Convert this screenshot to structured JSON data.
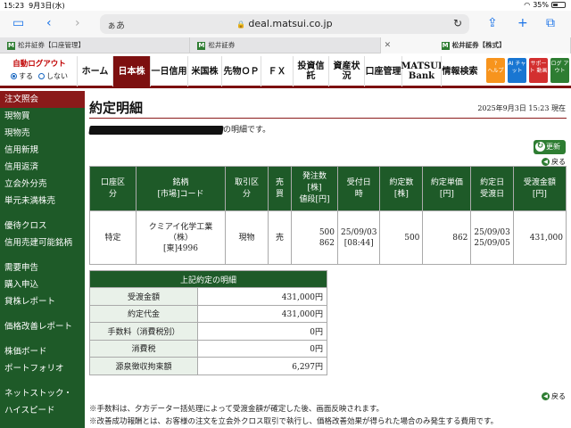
{
  "status_bar": {
    "time": "15:23",
    "date": "9月3日(水)",
    "battery": "35%"
  },
  "browser": {
    "aa": "ぁあ",
    "url": "deal.matsui.co.jp"
  },
  "tabs": [
    {
      "label": "松井証券【口座管理】"
    },
    {
      "label": "松井証券"
    },
    {
      "label": "松井証券【株式】"
    }
  ],
  "header": {
    "auto_logout_title": "自動ログアウト",
    "auto_logout_on": "する",
    "auto_logout_off": "しない",
    "nav": [
      "ホーム",
      "日本株",
      "一日信用",
      "米国株",
      "先物ＯＰ",
      "ＦＸ",
      "投資信託",
      "資産状況",
      "口座管理",
      "MATSUI Bank",
      "情報検索"
    ],
    "icons": [
      {
        "name": "help",
        "label": "ヘルプ",
        "color": "#f7941d"
      },
      {
        "name": "ai-chat",
        "label": "AI チャット",
        "color": "#1976d2"
      },
      {
        "name": "support",
        "label": "サポート 動画",
        "color": "#d32f2f"
      },
      {
        "name": "logout",
        "label": "ログ アウト",
        "color": "#2e7d32"
      }
    ]
  },
  "sidebar": {
    "items": [
      "注文照会",
      "現物買",
      "現物売",
      "信用新規",
      "信用返済",
      "立会外分売",
      "単元未満株売",
      "",
      "優待クロス",
      "信用売建可能銘柄",
      "",
      "需要申告",
      "購入申込",
      "貸株レポート",
      "",
      "価格改善レポート",
      "",
      "株価ボード",
      "ポートフォリオ",
      "",
      "ネットストック・",
      "ハイスピード"
    ]
  },
  "main": {
    "title": "約定明細",
    "timestamp": "2025年9月3日 15:23 現在",
    "notice_suffix": "の明細です。",
    "refresh_label": "更新",
    "back_label": "戻る",
    "execution_table": {
      "headers": [
        "口座区分",
        "銘柄 [市場]コード",
        "取引区分",
        "売買",
        "発注数 [株] 値段[円]",
        "受付日時",
        "約定数 [株]",
        "約定単価 [円]",
        "約定日 受渡日",
        "受渡金額 [円]"
      ],
      "row": {
        "account": "特定",
        "stock_name": "クミアイ化学工業（株）",
        "stock_code": "[東]4996",
        "trade_type": "現物",
        "side": "売",
        "order_qty": "500",
        "order_price": "862",
        "accept_date": "25/09/03",
        "accept_time": "[08:44]",
        "exec_qty": "500",
        "exec_price": "862",
        "exec_date": "25/09/03",
        "settle_date": "25/09/05",
        "settle_amount": "431,000"
      }
    },
    "summary": {
      "title": "上記約定の明細",
      "rows": [
        {
          "label": "受渡金額",
          "value": "431,000円"
        },
        {
          "label": "約定代金",
          "value": "431,000円"
        },
        {
          "label": "手数料（消費税別）",
          "value": "0円"
        },
        {
          "label": "消費税",
          "value": "0円"
        },
        {
          "label": "源泉徴収拘束額",
          "value": "6,297円"
        }
      ]
    },
    "notes": [
      "※手数料は、夕方データー括処理によって受渡金額が確定した後、画面反映されます。",
      "※改善成功報酬とは、お客様の注文を立会外クロス取引で執行し、価格改善効果が得られた場合のみ発生する費用です。"
    ]
  }
}
